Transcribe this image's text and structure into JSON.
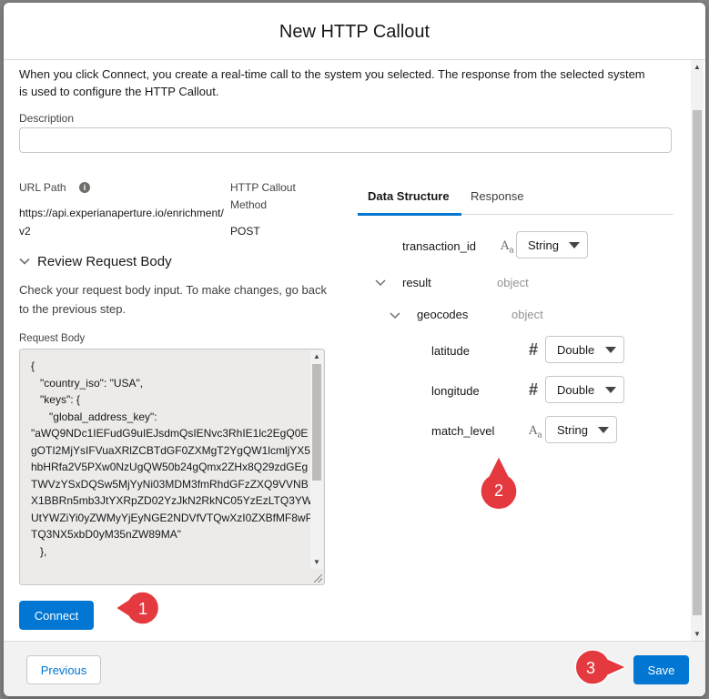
{
  "modal": {
    "title": "New HTTP Callout"
  },
  "intro": "When you click Connect, you create a real-time call to the system you selected. The response from the selected system is used to configure the HTTP Callout.",
  "description": {
    "label": "Description",
    "value": ""
  },
  "url_path": {
    "label": "URL Path",
    "value": "https://api.experianaperture.io/enrichment/v2"
  },
  "method": {
    "label": "HTTP Callout Method",
    "value": "POST"
  },
  "review": {
    "title": "Review Request Body",
    "help": "Check your request body input. To make changes, go back to the previous step.",
    "body_label": "Request Body",
    "body": "{\n   \"country_iso\": \"USA\",\n   \"keys\": {\n      \"global_address_key\":\n\"aWQ9NDc1IEFudG9uIEJsdmQsIENvc3RhIE1lc2EgQ0EgOTI2MjYsIFVuaXRlZCBTdGF0ZXMgT2YgQW1lcmljYX5hbHRfa2V5PXw0NzUgQW50b24gQmx2ZHx8Q29zdGEgTWVzYSxDQSw5MjYyNi03MDM3fmRhdGFzZXQ9VVNBX1BBRn5mb3JtYXRpZD02YzJkN2RkNC05YzEzLTQ3YWUtYWZiYi0yZWMyYjEyNGE2NDVfVTQwXzI0ZXBfMF8wPTQ3NX5xbD0yM35nZW89MA\"\n   },"
  },
  "buttons": {
    "connect": "Connect",
    "previous": "Previous",
    "save": "Save"
  },
  "tabs": [
    {
      "label": "Data Structure"
    },
    {
      "label": "Response"
    }
  ],
  "tree": {
    "transaction_id": {
      "name": "transaction_id",
      "type": "String"
    },
    "result": {
      "name": "result",
      "type": "object"
    },
    "geocodes": {
      "name": "geocodes",
      "type": "object"
    },
    "latitude": {
      "name": "latitude",
      "type": "Double"
    },
    "longitude": {
      "name": "longitude",
      "type": "Double"
    },
    "match_level": {
      "name": "match_level",
      "type": "String"
    }
  },
  "callouts": {
    "one": "1",
    "two": "2",
    "three": "3",
    "color": "#e4393f"
  },
  "colors": {
    "brand": "#0176d3"
  }
}
